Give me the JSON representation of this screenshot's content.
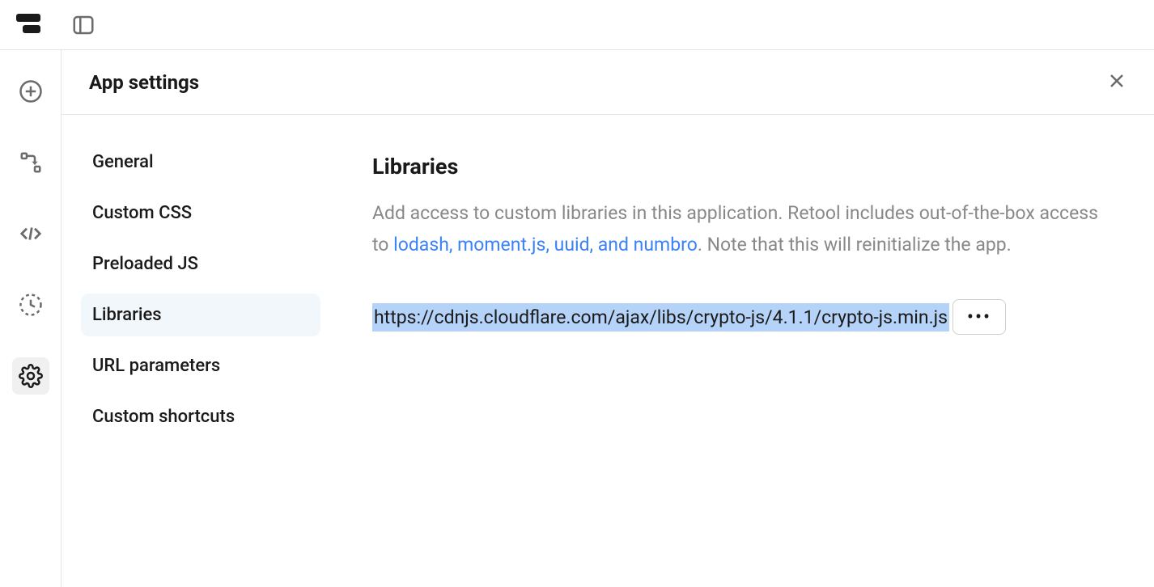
{
  "header": {
    "title": "App settings"
  },
  "nav": {
    "items": [
      {
        "label": "General"
      },
      {
        "label": "Custom CSS"
      },
      {
        "label": "Preloaded JS"
      },
      {
        "label": "Libraries"
      },
      {
        "label": "URL parameters"
      },
      {
        "label": "Custom shortcuts"
      }
    ]
  },
  "content": {
    "heading": "Libraries",
    "desc_before": "Add access to custom libraries in this application. Retool includes out-of-the-box access to ",
    "desc_link": "lodash, moment.js, uuid, and numbro",
    "desc_after": ". Note that this will reinitialize the app.",
    "library_url": "https://cdnjs.cloudflare.com/ajax/libs/crypto-js/4.1.1/crypto-js.min.js"
  }
}
